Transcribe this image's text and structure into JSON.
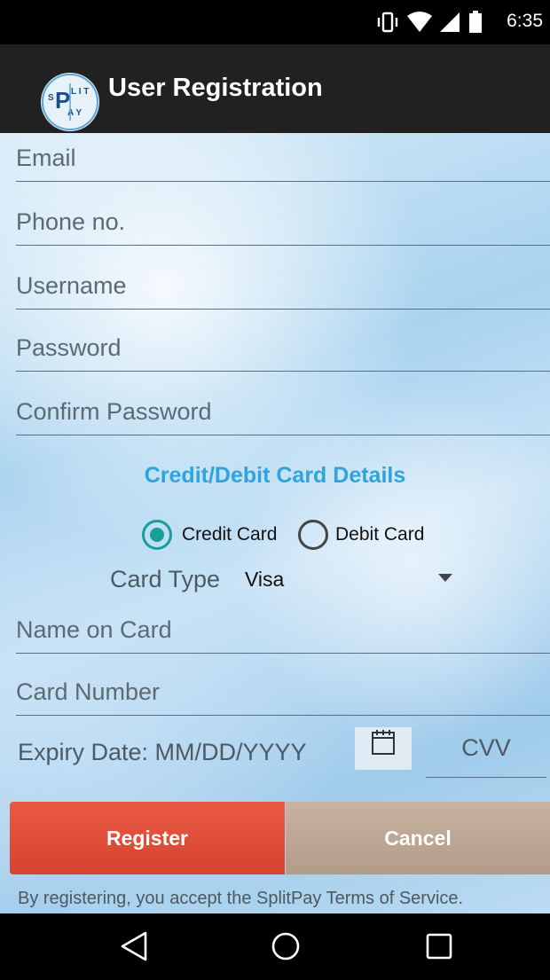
{
  "status_bar": {
    "time": "6:35"
  },
  "app_bar": {
    "logo_text": "SPLIT PAY",
    "title": "User Registration"
  },
  "form": {
    "email_placeholder": "Email",
    "phone_placeholder": "Phone no.",
    "username_placeholder": "Username",
    "password_placeholder": "Password",
    "confirm_password_placeholder": "Confirm Password",
    "card_section_title": "Credit/Debit Card Details",
    "card_kind": {
      "options": [
        "Credit Card",
        "Debit Card"
      ],
      "selected": "Credit Card"
    },
    "card_type_label": "Card Type",
    "card_type_value": "Visa",
    "name_on_card_placeholder": "Name on Card",
    "card_number_placeholder": "Card Number",
    "expiry_placeholder": "Expiry Date: MM/DD/YYYY",
    "cvv_placeholder": "CVV"
  },
  "buttons": {
    "register": "Register",
    "cancel": "Cancel"
  },
  "terms_text": "By registering, you accept the SplitPay Terms of Service.",
  "colors": {
    "accent_title": "#2fa4dc",
    "radio_selected": "#1a9e94",
    "register_button": "#e04f3a",
    "cancel_button": "#bca592",
    "app_bar": "#212121"
  },
  "icons": [
    "vibrate-icon",
    "wifi-icon",
    "signal-icon",
    "battery-icon",
    "calendar-icon",
    "back-icon",
    "home-icon",
    "recents-icon",
    "dropdown-arrow-icon"
  ]
}
